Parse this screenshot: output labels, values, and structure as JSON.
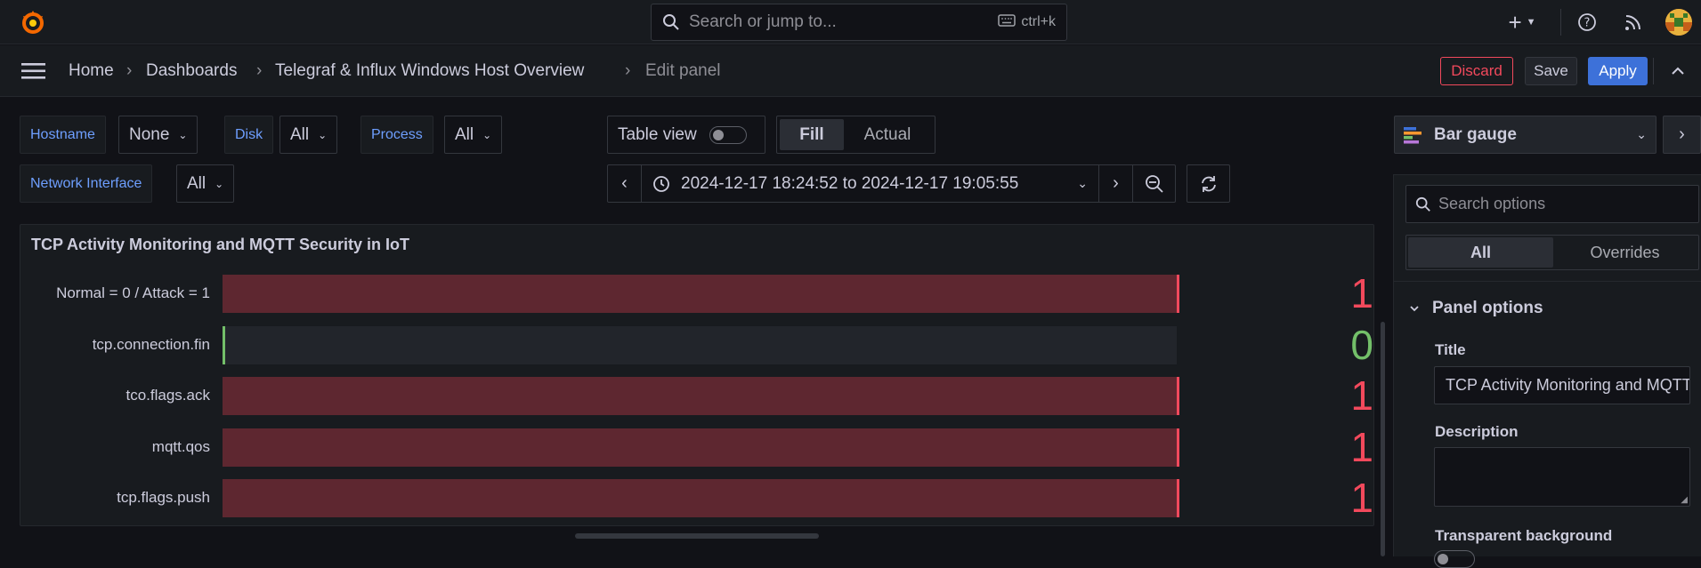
{
  "topbar": {
    "search_placeholder": "Search or jump to...",
    "search_shortcut": "ctrl+k"
  },
  "breadcrumbs": {
    "home": "Home",
    "dashboards": "Dashboards",
    "dashboard": "Telegraf & Influx Windows Host Overview",
    "current": "Edit panel",
    "separator": "›"
  },
  "actions": {
    "discard": "Discard",
    "save": "Save",
    "apply": "Apply"
  },
  "variables": {
    "hostname_label": "Hostname",
    "hostname_value": "None",
    "disk_label": "Disk",
    "disk_value": "All",
    "process_label": "Process",
    "process_value": "All",
    "netif_label": "Network Interface",
    "netif_value": "All"
  },
  "toolbar": {
    "table_view": "Table view",
    "fill": "Fill",
    "actual": "Actual",
    "time_range": "2024-12-17 18:24:52 to 2024-12-17 19:05:55"
  },
  "panel": {
    "title": "TCP Activity Monitoring and MQTT Security in IoT",
    "rows": [
      {
        "label": "Normal = 0 / Attack = 1",
        "value": "1",
        "fraction": 1
      },
      {
        "label": "tcp.connection.fin",
        "value": "0",
        "fraction": 0
      },
      {
        "label": "tco.flags.ack",
        "value": "1",
        "fraction": 1
      },
      {
        "label": "mqtt.qos",
        "value": "1",
        "fraction": 1
      },
      {
        "label": "tcp.flags.push",
        "value": "1",
        "fraction": 1
      }
    ]
  },
  "options": {
    "visualization": "Bar gauge",
    "search_placeholder": "Search options",
    "tab_all": "All",
    "tab_overrides": "Overrides",
    "section": "Panel options",
    "title_label": "Title",
    "title_value": "TCP Activity Monitoring and MQTT Security in IoT",
    "description_label": "Description",
    "transparent_label": "Transparent background"
  },
  "colors": {
    "attack": "#f2495c",
    "normal": "#73bf69",
    "accent": "#3d71d9"
  }
}
